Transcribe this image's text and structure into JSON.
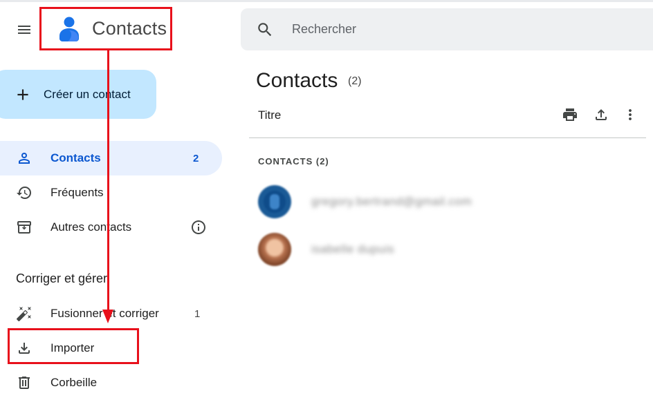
{
  "header": {
    "app_title": "Contacts",
    "search_placeholder": "Rechercher"
  },
  "sidebar": {
    "create_label": "Créer un contact",
    "items": [
      {
        "label": "Contacts",
        "count": "2"
      },
      {
        "label": "Fréquents"
      },
      {
        "label": "Autres contacts"
      }
    ],
    "section_title": "Corriger et gérer",
    "manage_items": [
      {
        "label": "Fusionner et corriger",
        "count": "1"
      },
      {
        "label": "Importer"
      },
      {
        "label": "Corbeille"
      }
    ]
  },
  "main": {
    "title": "Contacts",
    "count": "(2)",
    "column_title": "Titre",
    "group_title": "CONTACTS (2)",
    "rows": [
      {
        "name": "gregory.bertrand@gmail.com"
      },
      {
        "name": "isabelle dupuis"
      }
    ]
  },
  "colors": {
    "accent": "#0b57d0",
    "create_button_bg": "#c2e7ff",
    "active_nav_bg": "#e8f0fe",
    "annotation_red": "#e8101b"
  },
  "icons": [
    "menu-icon",
    "contacts-logo-icon",
    "search-icon",
    "plus-icon",
    "person-icon",
    "history-icon",
    "archive-icon",
    "info-icon",
    "magic-wand-icon",
    "download-icon",
    "trash-icon",
    "print-icon",
    "export-icon",
    "more-vert-icon"
  ]
}
